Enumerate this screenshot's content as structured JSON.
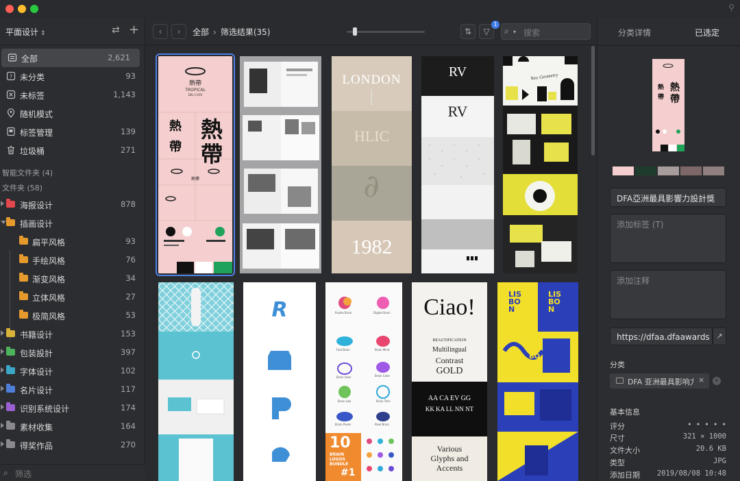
{
  "window": {
    "pin_icon": "pin-icon"
  },
  "sidebar": {
    "library_name": "平面设计",
    "smart_folders_label": "智能文件夹 (4)",
    "folders_label": "文件夹 (58)",
    "filter_placeholder": "筛选",
    "items": [
      {
        "label": "全部",
        "count": "2,621",
        "icon": "all-icon"
      },
      {
        "label": "未分类",
        "count": "93",
        "icon": "uncategorized-icon"
      },
      {
        "label": "未标签",
        "count": "1,143",
        "icon": "untagged-icon"
      },
      {
        "label": "随机模式",
        "count": "",
        "icon": "location-pin-icon"
      },
      {
        "label": "标签管理",
        "count": "139",
        "icon": "tag-manager-icon"
      },
      {
        "label": "垃圾桶",
        "count": "271",
        "icon": "trash-icon"
      }
    ],
    "folders": [
      {
        "label": "海报设计",
        "count": "878",
        "color": "#e2474b"
      },
      {
        "label": "插画设计",
        "count": "",
        "color": "#e69a2e"
      },
      {
        "label": "扁平风格",
        "count": "93",
        "color": "#e69a2e"
      },
      {
        "label": "手绘风格",
        "count": "76",
        "color": "#e69a2e"
      },
      {
        "label": "渐变风格",
        "count": "34",
        "color": "#e69a2e"
      },
      {
        "label": "立体风格",
        "count": "27",
        "color": "#e69a2e"
      },
      {
        "label": "极简风格",
        "count": "53",
        "color": "#e69a2e"
      },
      {
        "label": "书籍设计",
        "count": "153",
        "color": "#d9b23a"
      },
      {
        "label": "包装設計",
        "count": "397",
        "color": "#4cb35a"
      },
      {
        "label": "字体设计",
        "count": "102",
        "color": "#3aa7c9"
      },
      {
        "label": "名片设计",
        "count": "117",
        "color": "#4d7fd9"
      },
      {
        "label": "识别系统设计",
        "count": "174",
        "color": "#9a5fd1"
      },
      {
        "label": "素材收集",
        "count": "164",
        "color": "#8a8a8e"
      },
      {
        "label": "得奖作品",
        "count": "270",
        "color": "#8a8a8e"
      }
    ]
  },
  "toolbar": {
    "breadcrumb_root": "全部",
    "breadcrumb_current": "筛选结果(35)",
    "filter_badge": "1",
    "search_placeholder": "搜索",
    "zoom_level": 0.08
  },
  "cards": {
    "card1": {
      "tropical_title": "熱帶",
      "tropical_sub": "TROPICAL",
      "tropical_cafe": "DELI CAFE",
      "glyph_a": "熱",
      "glyph_b": "帶"
    },
    "card3": {
      "top": "LONDON",
      "mid": "HLIC",
      "year": "1982"
    },
    "card4": {
      "logo": "RV"
    },
    "card5": {
      "title": "Neo Geometry"
    },
    "card7": {
      "letter": "R"
    },
    "card8": {
      "labels": [
        "Puzzle Brain",
        "Digital Brain",
        "Fast Brain",
        "Brain Mind",
        "Brain Gear",
        "Brain Color",
        "Brain Lab",
        "Brain Tech",
        "Brain Pixels",
        "Pixel Brain"
      ],
      "promo_num": "10",
      "promo_text": "BRAIN\nLOGOS\nBUNDLE",
      "promo_tag": "#1"
    },
    "card9": {
      "title": "Ciao!",
      "lines": [
        "BEAUTIFICATION",
        "Multilingual",
        "Contrast",
        "GOLD"
      ],
      "alphabet": "AA CA EV GG",
      "alphabet2": "KK KA LL NN NT",
      "bottom": "Various\nGlyphs and\nAccents"
    },
    "card10": {
      "logo": "LIS\nBO\nN"
    }
  },
  "panel": {
    "tab_category_details": "分类详情",
    "tab_selected": "已选定",
    "swatches": [
      "#f5cfcf",
      "#1f3b2c",
      "#a79c9c",
      "#7e6867",
      "#8f7f7e"
    ],
    "name": "DFA亞洲最具影響力設計獎",
    "tags_placeholder": "添加标签 (T)",
    "notes_placeholder": "添加注释",
    "url": "https://dfaa.dfaawards",
    "category_label": "分类",
    "category_value": "DFA 亚洲最具影响力",
    "info_label": "基本信息",
    "info": [
      {
        "k": "评分",
        "v": "• • • • •"
      },
      {
        "k": "尺寸",
        "v": "321 × 1000"
      },
      {
        "k": "文件大小",
        "v": "20.6 KB"
      },
      {
        "k": "类型",
        "v": "JPG"
      },
      {
        "k": "添加日期",
        "v": "2019/08/08 10:48"
      }
    ]
  }
}
